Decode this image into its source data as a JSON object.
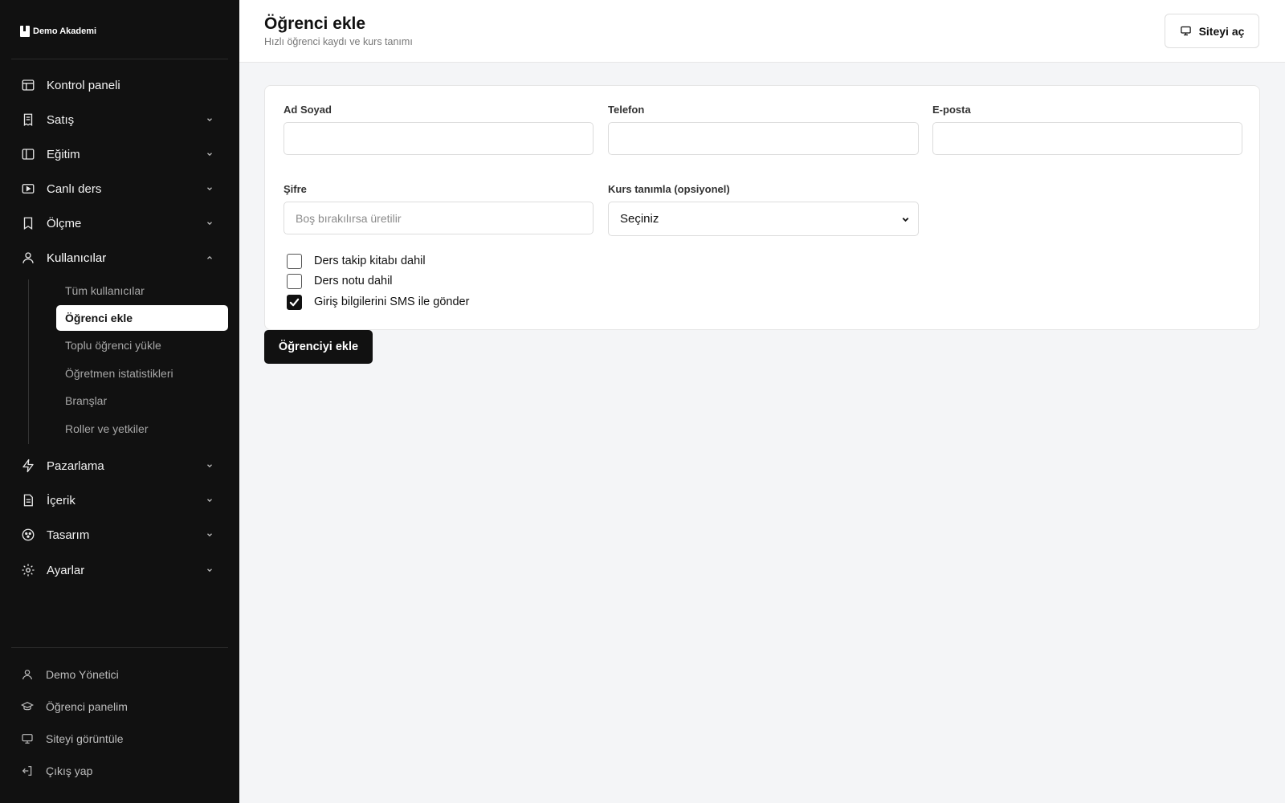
{
  "brand": {
    "name": "Demo Akademi"
  },
  "sidebar": {
    "items": [
      {
        "label": "Kontrol paneli",
        "icon": "layout-icon"
      },
      {
        "label": "Satış",
        "icon": "receipt-icon"
      },
      {
        "label": "Eğitim",
        "icon": "book-icon"
      },
      {
        "label": "Canlı ders",
        "icon": "video-icon"
      },
      {
        "label": "Ölçme",
        "icon": "bookmark-icon"
      },
      {
        "label": "Kullanıcılar",
        "icon": "user-icon"
      },
      {
        "label": "Pazarlama",
        "icon": "bolt-icon"
      },
      {
        "label": "İçerik",
        "icon": "document-icon"
      },
      {
        "label": "Tasarım",
        "icon": "palette-icon"
      },
      {
        "label": "Ayarlar",
        "icon": "gear-icon"
      }
    ],
    "sub_items": [
      {
        "label": "Tüm kullanıcılar"
      },
      {
        "label": "Öğrenci ekle"
      },
      {
        "label": "Toplu öğrenci yükle"
      },
      {
        "label": "Öğretmen istatistikleri"
      },
      {
        "label": "Branşlar"
      },
      {
        "label": "Roller ve yetkiler"
      }
    ],
    "bottom": [
      {
        "label": "Demo Yönetici",
        "icon": "user-icon"
      },
      {
        "label": "Öğrenci panelim",
        "icon": "graduation-cap-icon"
      },
      {
        "label": "Siteyi görüntüle",
        "icon": "monitor-icon"
      },
      {
        "label": "Çıkış yap",
        "icon": "logout-icon"
      }
    ]
  },
  "header": {
    "title": "Öğrenci ekle",
    "subtitle": "Hızlı öğrenci kaydı ve kurs tanımı",
    "open_site": "Siteyi aç"
  },
  "form": {
    "name_label": "Ad Soyad",
    "name_value": "",
    "phone_label": "Telefon",
    "phone_value": "",
    "email_label": "E-posta",
    "email_value": "",
    "password_label": "Şifre",
    "password_value": "",
    "password_placeholder": "Boş bırakılırsa üretilir",
    "course_label": "Kurs tanımla (opsiyonel)",
    "course_selected": "Seçiniz",
    "checkboxes": [
      {
        "label": "Ders takip kitabı dahil",
        "checked": false
      },
      {
        "label": "Ders notu dahil",
        "checked": false
      },
      {
        "label": "Giriş bilgilerini SMS ile gönder",
        "checked": true
      }
    ],
    "submit": "Öğrenciyi ekle"
  }
}
